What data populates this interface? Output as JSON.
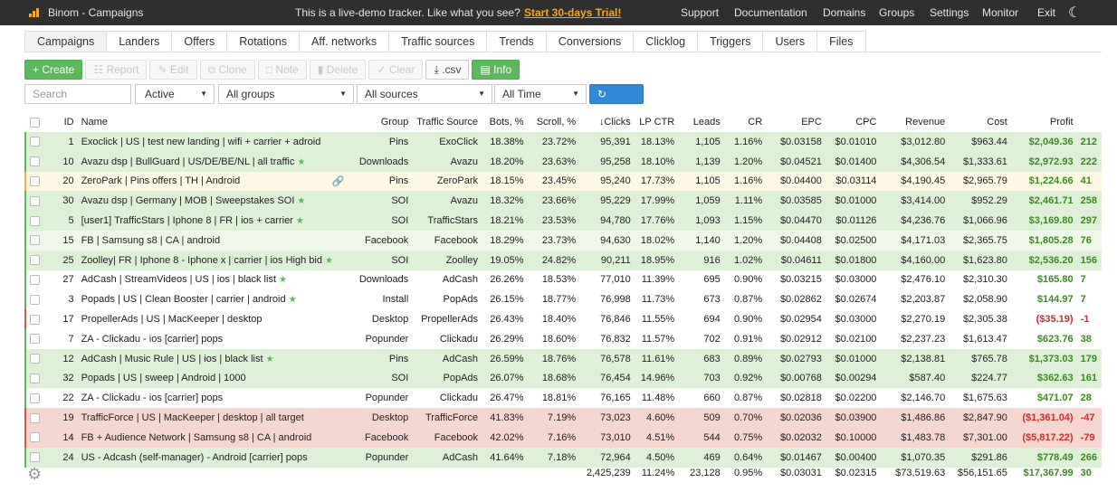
{
  "header": {
    "title": "Binom - Campaigns",
    "promo": "This is a live-demo tracker. Like what you see?",
    "trial": "Start 30-days Trial!",
    "nav": [
      "Support",
      "Documentation",
      "Domains",
      "Groups",
      "Settings",
      "Monitor",
      "Exit"
    ],
    "logo_icon": "bar-chart-logo",
    "theme_icon": "moon-icon"
  },
  "tabs": [
    "Campaigns",
    "Landers",
    "Offers",
    "Rotations",
    "Aff. networks",
    "Traffic sources",
    "Trends",
    "Conversions",
    "Clicklog",
    "Triggers",
    "Users",
    "Files"
  ],
  "toolbar": {
    "create": "+ Create",
    "report": "Report",
    "edit": "Edit",
    "clone": "Clone",
    "note": "Note",
    "delete": "Delete",
    "clear": "Clear",
    "csv": ".csv",
    "info": "Info"
  },
  "filters": {
    "search_placeholder": "Search",
    "status": "Active",
    "group": "All groups",
    "source": "All sources",
    "period": "All Time",
    "refresh": "Refresh"
  },
  "columns": [
    "ID",
    "Name",
    "Group",
    "Traffic Source",
    "Bots, %",
    "Scroll, %",
    "Clicks",
    "LP CTR",
    "Leads",
    "CR",
    "EPC",
    "CPC",
    "Revenue",
    "Cost",
    "Profit",
    ""
  ],
  "rows": [
    {
      "id": "1",
      "name": "Exoclick | US | test new landing | wifi + carrier + adroid",
      "star": false,
      "link": false,
      "group": "Pins",
      "source": "ExoClick",
      "bots": "18.38%",
      "scroll": "23.72%",
      "clicks": "95,391",
      "lpctr": "18.13%",
      "leads": "1,105",
      "cr": "1.16%",
      "epc": "$0.03158",
      "cpc": "$0.01010",
      "revenue": "$3,012.80",
      "cost": "$963.44",
      "profit": "$2,049.36",
      "extra": "212",
      "style": "green",
      "side": "green"
    },
    {
      "id": "10",
      "name": "Avazu dsp | BullGuard | US/DE/BE/NL | all traffic",
      "star": true,
      "link": false,
      "group": "Downloads",
      "source": "Avazu",
      "bots": "18.20%",
      "scroll": "23.63%",
      "clicks": "95,258",
      "lpctr": "18.10%",
      "leads": "1,139",
      "cr": "1.20%",
      "epc": "$0.04521",
      "cpc": "$0.01400",
      "revenue": "$4,306.54",
      "cost": "$1,333.61",
      "profit": "$2,972.93",
      "extra": "222",
      "style": "green",
      "side": "green"
    },
    {
      "id": "20",
      "name": "ZeroPark | Pins offers | TH | Android",
      "star": false,
      "link": true,
      "group": "Pins",
      "source": "ZeroPark",
      "bots": "18.15%",
      "scroll": "23.45%",
      "clicks": "95,240",
      "lpctr": "17.73%",
      "leads": "1,105",
      "cr": "1.16%",
      "epc": "$0.04400",
      "cpc": "$0.03114",
      "revenue": "$4,190.45",
      "cost": "$2,965.79",
      "profit": "$1,224.66",
      "extra": "41",
      "style": "yellow",
      "side": "yellow"
    },
    {
      "id": "30",
      "name": "Avazu dsp | Germany | MOB | Sweepstakes SOI",
      "star": true,
      "link": false,
      "group": "SOI",
      "source": "Avazu",
      "bots": "18.32%",
      "scroll": "23.66%",
      "clicks": "95,229",
      "lpctr": "17.99%",
      "leads": "1,059",
      "cr": "1.11%",
      "epc": "$0.03585",
      "cpc": "$0.01000",
      "revenue": "$3,414.00",
      "cost": "$952.29",
      "profit": "$2,461.71",
      "extra": "258",
      "style": "green",
      "side": "green"
    },
    {
      "id": "5",
      "name": "[user1] TrafficStars | Iphone 8 | FR | ios + carrier",
      "star": true,
      "link": false,
      "group": "SOI",
      "source": "TrafficStars",
      "bots": "18.21%",
      "scroll": "23.53%",
      "clicks": "94,780",
      "lpctr": "17.76%",
      "leads": "1,093",
      "cr": "1.15%",
      "epc": "$0.04470",
      "cpc": "$0.01126",
      "revenue": "$4,236.76",
      "cost": "$1,066.96",
      "profit": "$3,169.80",
      "extra": "297",
      "style": "green",
      "side": "green"
    },
    {
      "id": "15",
      "name": "FB | Samsung s8 | CA | android",
      "star": false,
      "link": false,
      "group": "Facebook",
      "source": "Facebook",
      "bots": "18.29%",
      "scroll": "23.73%",
      "clicks": "94,630",
      "lpctr": "18.02%",
      "leads": "1,140",
      "cr": "1.20%",
      "epc": "$0.04408",
      "cpc": "$0.02500",
      "revenue": "$4,171.03",
      "cost": "$2,365.75",
      "profit": "$1,805.28",
      "extra": "76",
      "style": "lgreen",
      "side": "green"
    },
    {
      "id": "25",
      "name": "Zoolley| FR | Iphone 8 - Iphone x | carrier | ios High bid",
      "star": true,
      "link": false,
      "group": "SOI",
      "source": "Zoolley",
      "bots": "19.05%",
      "scroll": "24.82%",
      "clicks": "90,211",
      "lpctr": "18.95%",
      "leads": "916",
      "cr": "1.02%",
      "epc": "$0.04611",
      "cpc": "$0.01800",
      "revenue": "$4,160.00",
      "cost": "$1,623.80",
      "profit": "$2,536.20",
      "extra": "156",
      "style": "green",
      "side": "green"
    },
    {
      "id": "27",
      "name": "AdCash | StreamVideos | US | ios | black list",
      "star": true,
      "link": false,
      "group": "Downloads",
      "source": "AdCash",
      "bots": "26.26%",
      "scroll": "18.53%",
      "clicks": "77,010",
      "lpctr": "11.39%",
      "leads": "695",
      "cr": "0.90%",
      "epc": "$0.03215",
      "cpc": "$0.03000",
      "revenue": "$2,476.10",
      "cost": "$2,310.30",
      "profit": "$165.80",
      "extra": "7",
      "style": "white",
      "side": "green"
    },
    {
      "id": "3",
      "name": "Popads | US | Clean Booster | carrier | android",
      "star": true,
      "link": false,
      "group": "Install",
      "source": "PopAds",
      "bots": "26.15%",
      "scroll": "18.77%",
      "clicks": "76,998",
      "lpctr": "11.73%",
      "leads": "673",
      "cr": "0.87%",
      "epc": "$0.02862",
      "cpc": "$0.02674",
      "revenue": "$2,203.87",
      "cost": "$2,058.90",
      "profit": "$144.97",
      "extra": "7",
      "style": "white",
      "side": "green"
    },
    {
      "id": "17",
      "name": "PropellerAds | US | MacKeeper | desktop",
      "star": false,
      "link": false,
      "group": "Desktop",
      "source": "PropellerAds",
      "bots": "26.43%",
      "scroll": "18.40%",
      "clicks": "76,846",
      "lpctr": "11.55%",
      "leads": "694",
      "cr": "0.90%",
      "epc": "$0.02954",
      "cpc": "$0.03000",
      "revenue": "$2,270.19",
      "cost": "$2,305.38",
      "profit": "($35.19)",
      "extra": "-1",
      "style": "white",
      "side": "red"
    },
    {
      "id": "7",
      "name": "ZA - Clickadu - ios [carrier] pops",
      "star": false,
      "link": false,
      "group": "Popunder",
      "source": "Clickadu",
      "bots": "26.29%",
      "scroll": "18.60%",
      "clicks": "76,832",
      "lpctr": "11.57%",
      "leads": "702",
      "cr": "0.91%",
      "epc": "$0.02912",
      "cpc": "$0.02100",
      "revenue": "$2,237.23",
      "cost": "$1,613.47",
      "profit": "$623.76",
      "extra": "38",
      "style": "white",
      "side": "green"
    },
    {
      "id": "12",
      "name": "AdCash | Music Rule | US | ios | black list",
      "star": true,
      "link": false,
      "group": "Pins",
      "source": "AdCash",
      "bots": "26.59%",
      "scroll": "18.76%",
      "clicks": "76,578",
      "lpctr": "11.61%",
      "leads": "683",
      "cr": "0.89%",
      "epc": "$0.02793",
      "cpc": "$0.01000",
      "revenue": "$2,138.81",
      "cost": "$765.78",
      "profit": "$1,373.03",
      "extra": "179",
      "style": "green",
      "side": "green"
    },
    {
      "id": "32",
      "name": "Popads | US | sweep | Android | 1000",
      "star": false,
      "link": false,
      "group": "SOI",
      "source": "PopAds",
      "bots": "26.07%",
      "scroll": "18.68%",
      "clicks": "76,454",
      "lpctr": "14.96%",
      "leads": "703",
      "cr": "0.92%",
      "epc": "$0.00768",
      "cpc": "$0.00294",
      "revenue": "$587.40",
      "cost": "$224.77",
      "profit": "$362.63",
      "extra": "161",
      "style": "green",
      "side": "green"
    },
    {
      "id": "22",
      "name": "ZA - Clickadu - ios [carrier] pops",
      "star": false,
      "link": false,
      "group": "Popunder",
      "source": "Clickadu",
      "bots": "26.47%",
      "scroll": "18.81%",
      "clicks": "76,165",
      "lpctr": "11.48%",
      "leads": "660",
      "cr": "0.87%",
      "epc": "$0.02818",
      "cpc": "$0.02200",
      "revenue": "$2,146.70",
      "cost": "$1,675.63",
      "profit": "$471.07",
      "extra": "28",
      "style": "white",
      "side": "green"
    },
    {
      "id": "19",
      "name": "TrafficForce | US | MacKeeper | desktop | all target",
      "star": false,
      "link": false,
      "group": "Desktop",
      "source": "TrafficForce",
      "bots": "41.83%",
      "scroll": "7.19%",
      "clicks": "73,023",
      "lpctr": "4.60%",
      "leads": "509",
      "cr": "0.70%",
      "epc": "$0.02036",
      "cpc": "$0.03900",
      "revenue": "$1,486.86",
      "cost": "$2,847.90",
      "profit": "($1,361.04)",
      "extra": "-47",
      "style": "red",
      "side": "red"
    },
    {
      "id": "14",
      "name": "FB + Audience Network | Samsung s8 | CA | android",
      "star": false,
      "link": false,
      "group": "Facebook",
      "source": "Facebook",
      "bots": "42.02%",
      "scroll": "7.16%",
      "clicks": "73,010",
      "lpctr": "4.51%",
      "leads": "544",
      "cr": "0.75%",
      "epc": "$0.02032",
      "cpc": "$0.10000",
      "revenue": "$1,483.78",
      "cost": "$7,301.00",
      "profit": "($5,817.22)",
      "extra": "-79",
      "style": "red",
      "side": "red"
    },
    {
      "id": "24",
      "name": "US - Adcash (self-manager) - Android [carrier] pops",
      "star": false,
      "link": false,
      "group": "Popunder",
      "source": "AdCash",
      "bots": "41.64%",
      "scroll": "7.18%",
      "clicks": "72,964",
      "lpctr": "4.50%",
      "leads": "469",
      "cr": "0.64%",
      "epc": "$0.01467",
      "cpc": "$0.00400",
      "revenue": "$1,070.35",
      "cost": "$291.86",
      "profit": "$778.49",
      "extra": "266",
      "style": "green",
      "side": "green"
    }
  ],
  "totals": {
    "clicks": "2,425,239",
    "lpctr": "11.24%",
    "leads": "23,128",
    "cr": "0.95%",
    "epc": "$0.03031",
    "cpc": "$0.02315",
    "revenue": "$73,519.63",
    "cost": "$56,151.65",
    "profit": "$17,367.99",
    "extra": "30"
  },
  "colors": {
    "green_row": "#dff0d8",
    "red_row": "#f6d6d1",
    "yellow_row": "#fcf8e3",
    "profit_positive": "#3c8b22",
    "profit_negative": "#c9302c",
    "accent_blue": "#2f89d8"
  }
}
